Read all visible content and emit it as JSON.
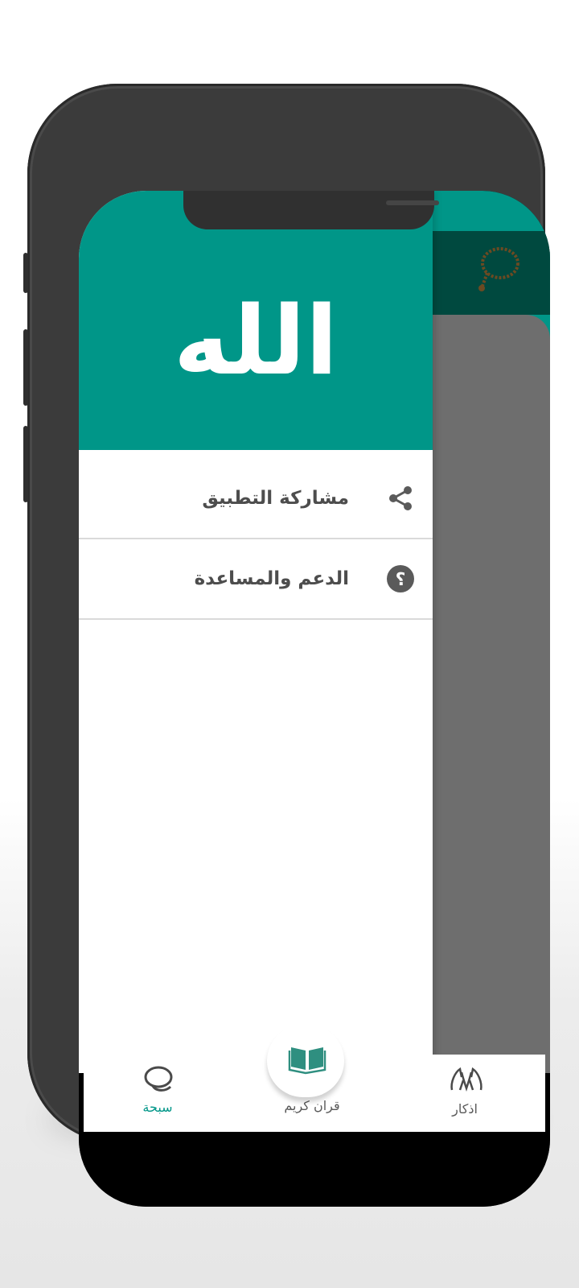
{
  "app": {
    "drawer_title": "الله",
    "menu": [
      {
        "label": "مشاركة التطبيق",
        "icon": "share-icon"
      },
      {
        "label": "الدعم والمساعدة",
        "icon": "help-icon"
      }
    ],
    "toolbar_icon": "prayer-beads-icon",
    "bottom_nav": {
      "items": [
        {
          "label": "سبحة",
          "icon": "prayer-beads-icon",
          "selected": true
        },
        {
          "label": "قران كريم",
          "icon": "open-book-icon",
          "selected": false
        },
        {
          "label": "اذكار",
          "icon": "praying-hands-icon",
          "selected": false
        }
      ]
    }
  },
  "colors": {
    "primary": "#009688",
    "primary_dark": "#00493f",
    "scrim": "#6e6e6e",
    "selected": "#009688",
    "text": "#4d4d4d",
    "beads": "#6b4a22"
  }
}
